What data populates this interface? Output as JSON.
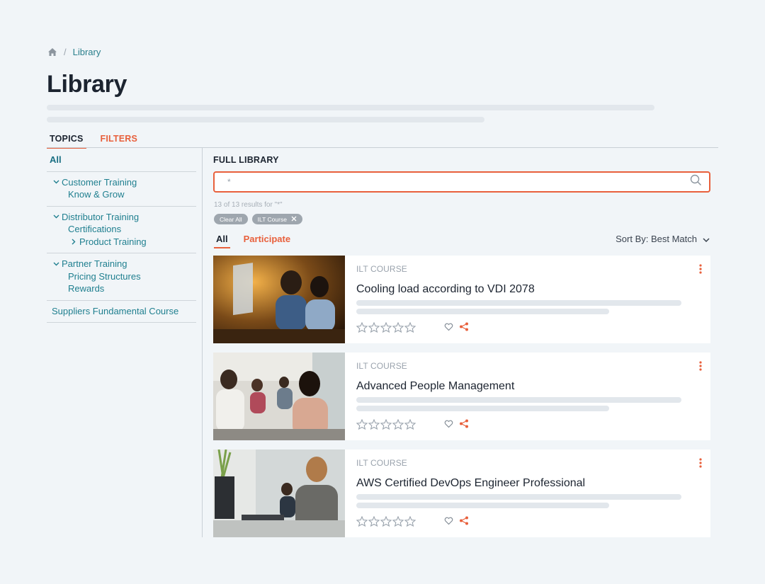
{
  "breadcrumb": {
    "home_icon": "home-icon",
    "separator": "/",
    "current": "Library"
  },
  "page": {
    "title": "Library"
  },
  "left_tabs": [
    {
      "label": "TOPICS",
      "active": true
    },
    {
      "label": "FILTERS",
      "active": false
    }
  ],
  "sidebar": {
    "all": "All",
    "groups": [
      {
        "label": "Customer Training",
        "children": [
          "Know & Grow"
        ]
      },
      {
        "label": "Distributor Training",
        "children": [
          "Certifications"
        ],
        "sub": "Product Training"
      },
      {
        "label": "Partner Training",
        "children": [
          "Pricing Structures",
          "Rewards"
        ]
      }
    ],
    "last": "Suppliers Fundamental Course"
  },
  "main": {
    "title": "FULL LIBRARY",
    "search": {
      "value": "*",
      "icon": "search-icon"
    },
    "results": "13 of 13 results for \"*\"",
    "chips": {
      "clear": "Clear All",
      "filter": "ILT Course"
    },
    "subtabs": [
      {
        "label": "All",
        "active": true
      },
      {
        "label": "Participate",
        "active": false
      }
    ],
    "sort": "Sort By: Best Match"
  },
  "cards": [
    {
      "type": "ILT COURSE",
      "title": "Cooling load according to VDI 2078"
    },
    {
      "type": "ILT COURSE",
      "title": "Advanced People Management"
    },
    {
      "type": "ILT COURSE",
      "title": "AWS Certified DevOps Engineer Professional"
    }
  ],
  "colors": {
    "accent": "#e8603c",
    "link": "#1f7f8f",
    "background": "#f1f5f8"
  }
}
